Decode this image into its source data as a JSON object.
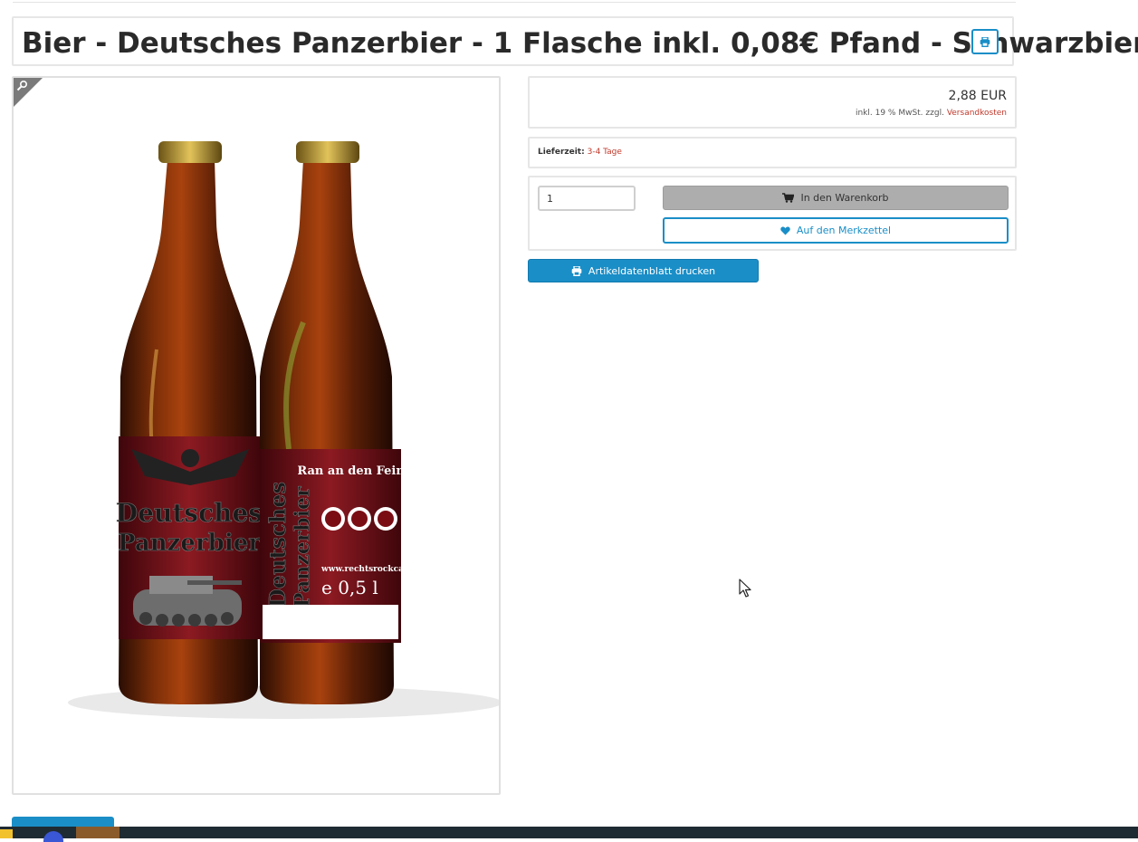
{
  "product": {
    "title": "Bier - Deutsches Panzerbier - 1 Flasche inkl. 0,08€ Pfand - Schwarzbier",
    "price": "2,88 EUR",
    "tax_note": "inkl. 19 % MwSt. zzgl.",
    "shipping_link": "Versandkosten",
    "delivery_label": "Lieferzeit:",
    "delivery_value": "3-4 Tage",
    "quantity": "1"
  },
  "actions": {
    "cart_label": "In den Warenkorb",
    "wishlist_label": "Auf den Merkzettel",
    "datasheet_label": "Artikeldatenblatt drucken"
  },
  "image": {
    "label_front_line1": "Deutsches",
    "label_front_line2": "Panzerbier",
    "label_back_title": "Ran an den Feind!",
    "label_back_volume": "e 0,5 l",
    "label_back_url": "www.rechtsrockcafe.de"
  },
  "colors": {
    "accent": "#1a8ec7",
    "link_red": "#c0392b",
    "cart_button": "#adadad",
    "bottle": "#5a2208",
    "label": "#6b0f16"
  },
  "icons": [
    "print-icon",
    "zoom-icon",
    "cart-icon",
    "heart-icon",
    "cursor-icon"
  ]
}
